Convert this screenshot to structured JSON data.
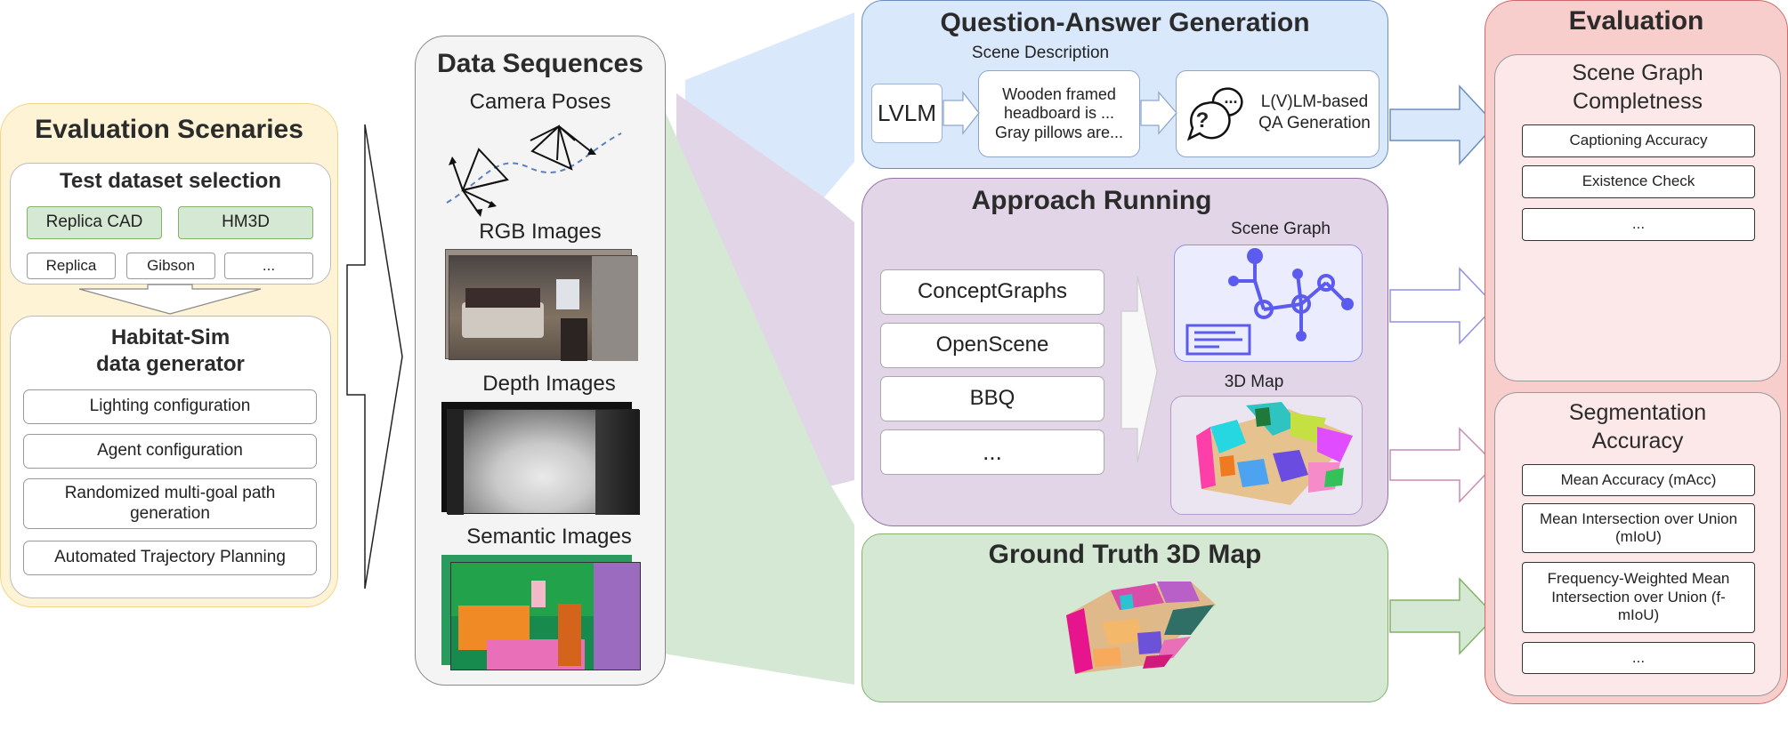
{
  "scenarios": {
    "title": "Evaluation Scenaries",
    "dataset": {
      "title": "Test dataset selection",
      "highlighted": [
        "Replica CAD",
        "HM3D"
      ],
      "others": [
        "Replica",
        "Gibson",
        "..."
      ]
    },
    "generator": {
      "title_line1": "Habitat-Sim",
      "title_line2": "data generator",
      "items": [
        "Lighting configuration",
        "Agent configuration",
        "Randomized multi-goal path generation",
        "Automated Trajectory Planning"
      ]
    }
  },
  "sequences": {
    "title": "Data Sequences",
    "camera": "Camera Poses",
    "rgb": "RGB Images",
    "depth": "Depth Images",
    "semantic": "Semantic Images"
  },
  "qa": {
    "title": "Question-Answer Generation",
    "scene_desc_label": "Scene Description",
    "lvlm": "LVLM",
    "desc_line1": "Wooden framed",
    "desc_line2": "headboard is ...",
    "desc_line3": "Gray  pillows are...",
    "gen_line1": "L(V)LM-based",
    "gen_line2": "QA Generation",
    "icon_mark": "?",
    "icon_dots": "..."
  },
  "approach": {
    "title": "Approach Running",
    "methods": [
      "ConceptGraphs",
      "OpenScene",
      "BBQ",
      "..."
    ],
    "scene_graph_label": "Scene Graph",
    "map_label": "3D Map"
  },
  "gt": {
    "title": "Ground Truth 3D Map"
  },
  "evaluation": {
    "title": "Evaluation",
    "completeness": {
      "title_line1": "Scene Graph",
      "title_line2": "Completness",
      "items": [
        "Captioning Accuracy",
        "Existence Check",
        "..."
      ]
    },
    "segmentation": {
      "title_line1": "Segmentation",
      "title_line2": "Accuracy",
      "items": [
        "Mean Accuracy (mAcc)",
        "Mean Intersection over Union (mIoU)",
        "Frequency-Weighted Mean Intersection over Union (f-mIoU)",
        "..."
      ]
    }
  },
  "colors": {
    "scenario_fill": "#fff3d6",
    "scenario_border": "#f3d58a",
    "green_fill": "#d5e8d4",
    "green_border": "#82b366",
    "blue_fill": "#dae8fc",
    "blue_border": "#6c8ebf",
    "purple_fill": "#e1d5e7",
    "purple_border": "#9673a6",
    "red_fill": "#f8cecc",
    "red_border": "#d06a6a",
    "graph_accent": "#5b5bef"
  }
}
